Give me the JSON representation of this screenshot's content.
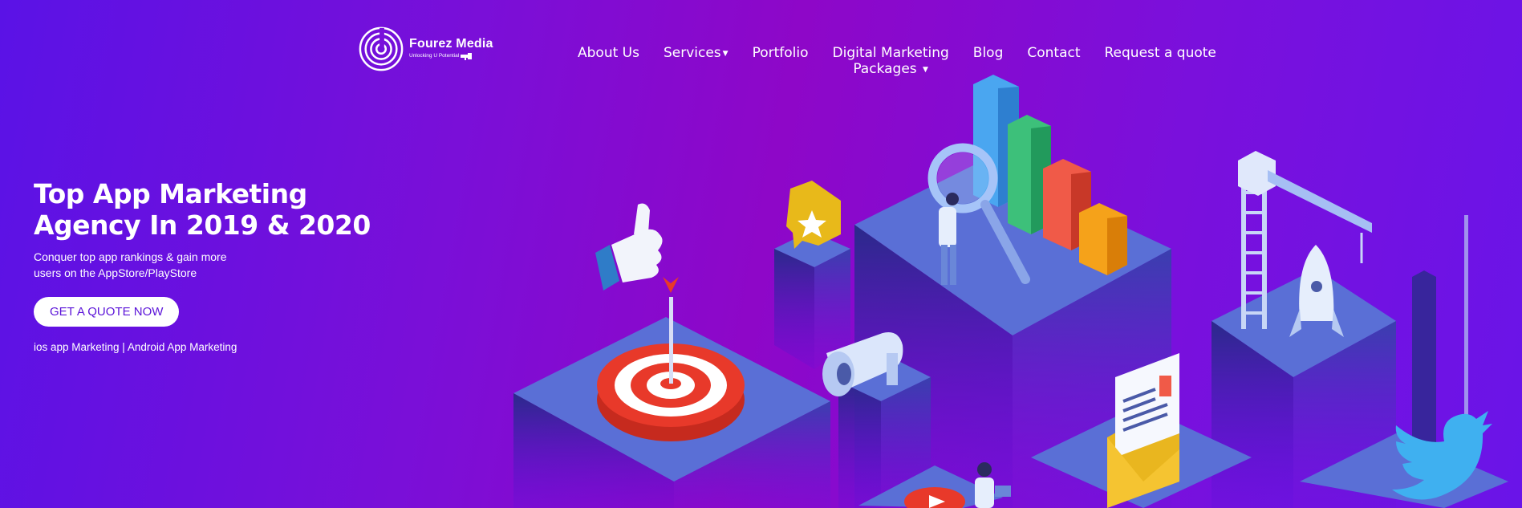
{
  "brand": {
    "name": "Fourez Media",
    "tagline": "Unlocking U Potential"
  },
  "nav": {
    "items": [
      {
        "label": "About Us"
      },
      {
        "label": "Services"
      },
      {
        "label": "Portfolio"
      },
      {
        "label": "Digital Marketing"
      },
      {
        "label": "Blog"
      },
      {
        "label": "Contact"
      },
      {
        "label": "Request a quote"
      }
    ],
    "packages_label": "Packages"
  },
  "hero": {
    "title_line1": "Top App Marketing",
    "title_line2": "Agency In 2019 & 2020",
    "subtitle_line1": "Conquer top app rankings & gain more",
    "subtitle_line2": "users on the AppStore/PlayStore",
    "cta_label": "GET A QUOTE NOW",
    "links": "ios app Marketing | Android App Marketing"
  },
  "colors": {
    "accent": "#5a12d8",
    "bg_left": "#5a12e6",
    "bg_center": "#8e07c8",
    "platform_top": "#5a6fd6",
    "target_red": "#e8392a",
    "twitter_blue": "#3fb0f0"
  },
  "icons": [
    "thumbs-up-icon",
    "star-chat-icon",
    "bar-chart-icon",
    "magnifier-icon",
    "target-icon",
    "megaphone-icon",
    "crane-icon",
    "rocket-icon",
    "envelope-icon",
    "twitter-bird-icon",
    "play-button-icon"
  ]
}
